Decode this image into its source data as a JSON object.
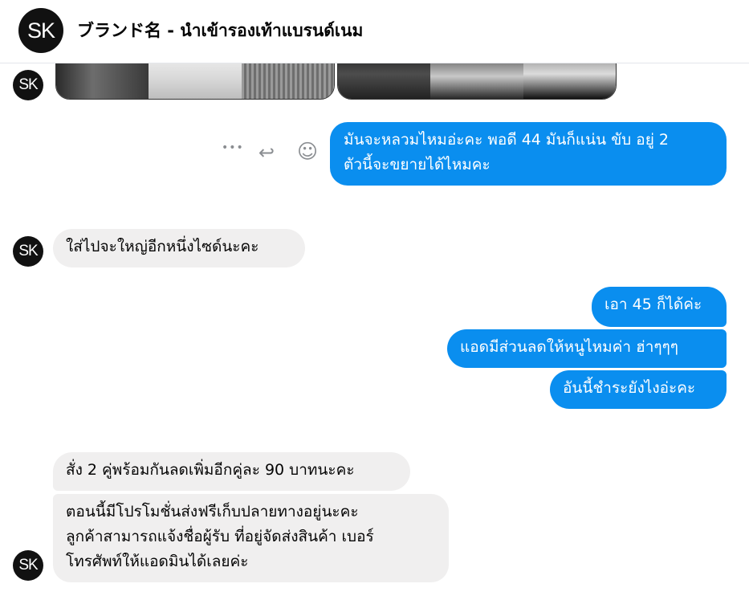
{
  "header": {
    "avatar_text": "SK",
    "title": "ブランド名 - นำเข้ารองเท้าแบรนด์เนม"
  },
  "avatars": {
    "text": "SK"
  },
  "actions": {
    "more_icon": "more-dots-icon",
    "reply_icon": "reply-arrow-icon",
    "react_icon": "smiley-icon",
    "more_glyph": "•••",
    "reply_glyph": "↩",
    "react_glyph": "☺"
  },
  "messages": [
    {
      "side": "out",
      "lines": [
        "มันจะหลวมไหมอ่ะคะ พอดี 44 มันก็แน่น ขับ อยู่ 2",
        "ตัวนี้จะขยายได้ไหมคะ"
      ]
    },
    {
      "side": "in",
      "lines": [
        "ใส่ไปจะใหญ่อีกหนึ่งไซด์นะคะ"
      ]
    },
    {
      "side": "out",
      "lines": [
        "เอา 45 ก็ได้ค่ะ"
      ]
    },
    {
      "side": "out",
      "lines": [
        "แอดมีส่วนลดให้หนูไหมค่า ฮ่าๆๆๆ"
      ]
    },
    {
      "side": "out",
      "lines": [
        "อันนี้ชำระยังไงอ่ะคะ"
      ]
    },
    {
      "side": "in",
      "lines": [
        "สั่ง 2 คู่พร้อมกันลดเพิ่มอีกคู่ละ 90 บาทนะคะ"
      ]
    },
    {
      "side": "in",
      "lines": [
        "ตอนนี้มีโปรโมชั่นส่งฟรีเก็บปลายทางอยู่นะคะ",
        "ลูกค้าสามารถแจ้งชื่อผู้รับ ที่อยู่จัดส่งสินค้า เบอร์",
        "โทรศัพท์ให้แอดมินได้เลยค่ะ"
      ]
    }
  ],
  "colors": {
    "outgoing": "#0a8eef",
    "incoming": "#f0efef",
    "action_icons": "#8a8d91"
  }
}
